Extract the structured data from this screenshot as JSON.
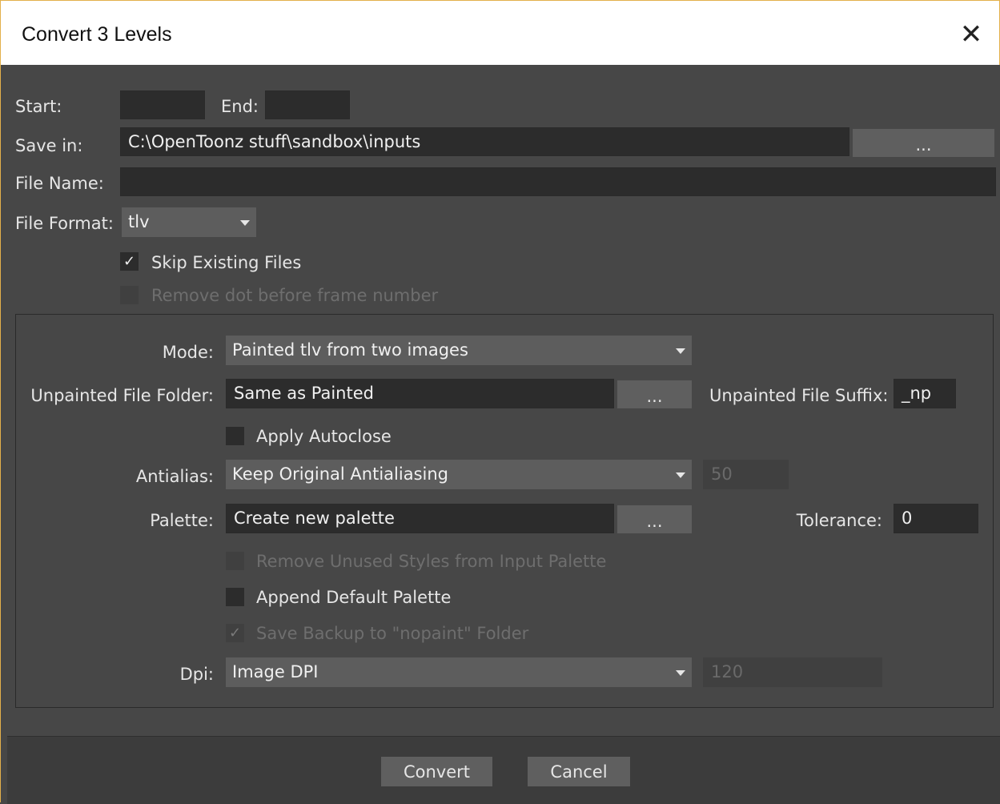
{
  "window": {
    "title": "Convert 3 Levels",
    "close_glyph": "✕"
  },
  "form": {
    "start_label": "Start:",
    "start_value": "",
    "end_label": "End:",
    "end_value": "",
    "save_in_label": "Save in:",
    "save_in_value": "C:\\OpenToonz stuff\\sandbox\\inputs",
    "browse_label": "...",
    "file_name_label": "File Name:",
    "file_name_value": "",
    "file_format_label": "File Format:",
    "file_format_value": "tlv",
    "skip_existing_label": "Skip Existing Files",
    "skip_existing_checked": true,
    "remove_dot_label": "Remove dot before frame number",
    "remove_dot_checked": false
  },
  "options": {
    "mode_label": "Mode:",
    "mode_value": "Painted tlv from two images",
    "unpainted_folder_label": "Unpainted File Folder:",
    "unpainted_folder_value": "Same as Painted",
    "unpainted_browse_label": "...",
    "unpainted_suffix_label": "Unpainted File Suffix:",
    "unpainted_suffix_value": "_np",
    "apply_autoclose_label": "Apply Autoclose",
    "apply_autoclose_checked": false,
    "antialias_label": "Antialias:",
    "antialias_value": "Keep Original Antialiasing",
    "antialias_amount": "50",
    "palette_label": "Palette:",
    "palette_value": "Create new palette",
    "palette_browse_label": "...",
    "tolerance_label": "Tolerance:",
    "tolerance_value": "0",
    "remove_unused_label": "Remove Unused Styles from Input Palette",
    "remove_unused_checked": false,
    "append_default_label": "Append Default Palette",
    "append_default_checked": false,
    "save_backup_label": "Save Backup to \"nopaint\" Folder",
    "save_backup_checked": true,
    "dpi_label": "Dpi:",
    "dpi_value": "Image DPI",
    "dpi_amount": "120"
  },
  "footer": {
    "convert_label": "Convert",
    "cancel_label": "Cancel"
  },
  "icons": {
    "check": "✓",
    "dropdown": "chevron-down-icon",
    "close": "close-icon"
  },
  "colors": {
    "window_border": "#e3b04b",
    "background": "#474747",
    "field": "#2c2c2c",
    "button": "#5f5f5f"
  }
}
